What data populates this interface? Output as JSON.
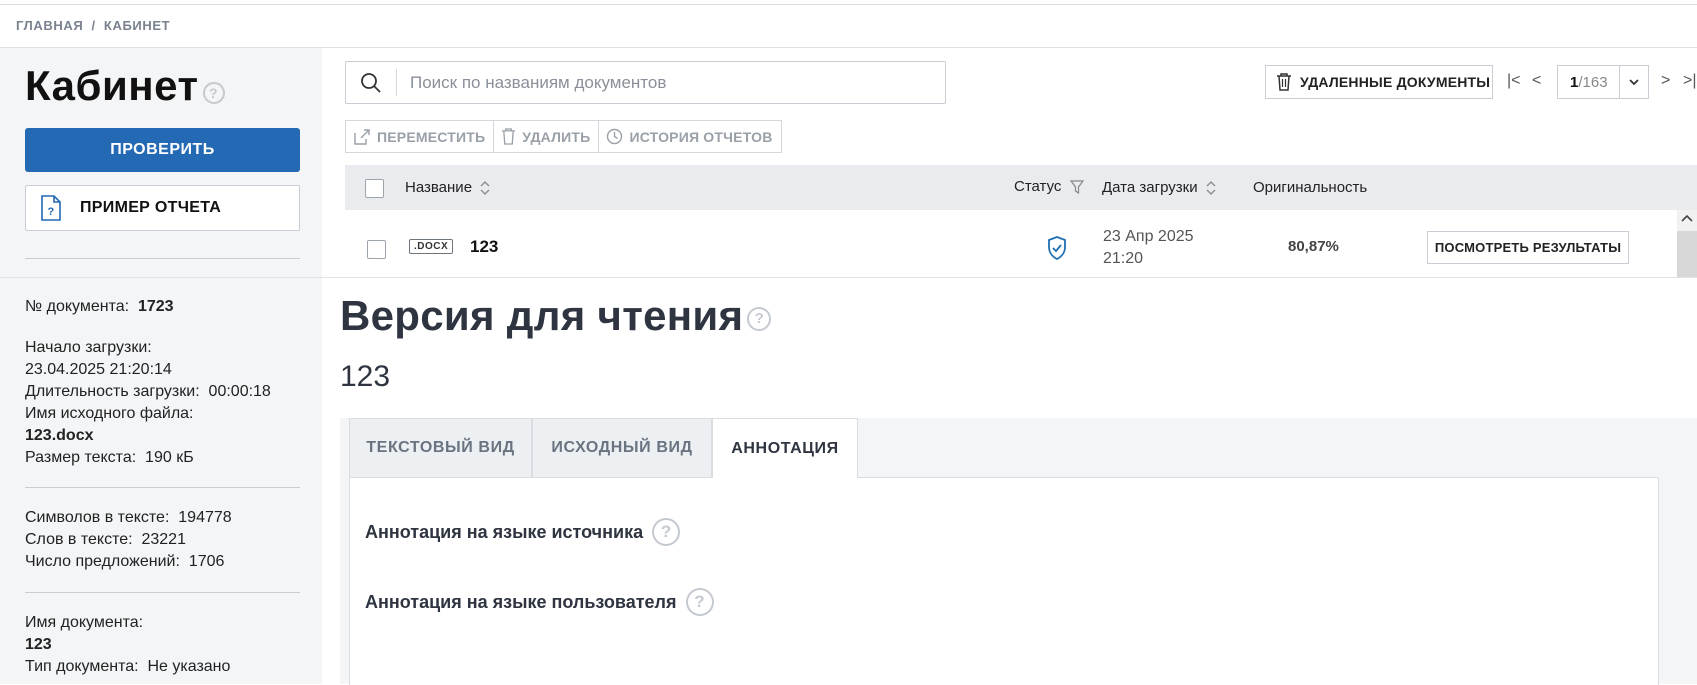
{
  "breadcrumb": {
    "home": "ГЛАВНАЯ",
    "sep": "/",
    "current": "КАБИНЕТ"
  },
  "sidebar": {
    "title": "Кабинет",
    "check_button": "ПРОВЕРИТЬ",
    "sample_button": "ПРИМЕР ОТЧЕТА",
    "doc_number_label": "№ документа:",
    "doc_number": "1723",
    "upload_start_label": "Начало загрузки:",
    "upload_start": "23.04.2025 21:20:14",
    "upload_duration_label": "Длительность загрузки:",
    "upload_duration": "00:00:18",
    "source_file_label": "Имя исходного файла:",
    "source_file": "123.docx",
    "text_size_label": "Размер текста:",
    "text_size": "190 кБ",
    "chars_label": "Символов в тексте:",
    "chars": "194778",
    "words_label": "Слов в тексте:",
    "words": "23221",
    "sentences_label": "Число предложений:",
    "sentences": "1706",
    "doc_name_label": "Имя документа:",
    "doc_name": "123",
    "doc_type_label": "Тип документа:",
    "doc_type": "Не указано"
  },
  "search": {
    "placeholder": "Поиск по названиям документов"
  },
  "deleted_button": "УДАЛЕННЫЕ ДОКУМЕНТЫ",
  "pager": {
    "current": "1",
    "total": "/163"
  },
  "toolbar": {
    "move": "ПЕРЕМЕСТИТЬ",
    "delete": "УДАЛИТЬ",
    "history": "ИСТОРИЯ ОТЧЕТОВ"
  },
  "table": {
    "headers": {
      "name": "Название",
      "status": "Статус",
      "date": "Дата загрузки",
      "originality": "Оригинальность"
    },
    "rows": [
      {
        "type": ".DOCX",
        "name": "123",
        "date_line1": "23 Апр 2025",
        "date_line2": "21:20",
        "originality": "80,87%",
        "action": "ПОСМОТРЕТЬ РЕЗУЛЬТАТЫ"
      }
    ]
  },
  "reader": {
    "title": "Версия для чтения",
    "doc_name": "123",
    "tabs": [
      "ТЕКСТОВЫЙ ВИД",
      "ИСХОДНЫЙ ВИД",
      "АННОТАЦИЯ"
    ],
    "active_tab": "АННОТАЦИЯ",
    "annotation_source": "Аннотация на языке источника",
    "annotation_user": "Аннотация на языке пользователя"
  },
  "colors": {
    "primary": "#2469b3",
    "status_icon": "#1f6fb5",
    "sidebar_bg": "#f3f5f7"
  },
  "icons": [
    "search-icon",
    "trash-icon",
    "move-icon",
    "history-icon",
    "help-icon",
    "shield-check-icon",
    "report-icon"
  ]
}
